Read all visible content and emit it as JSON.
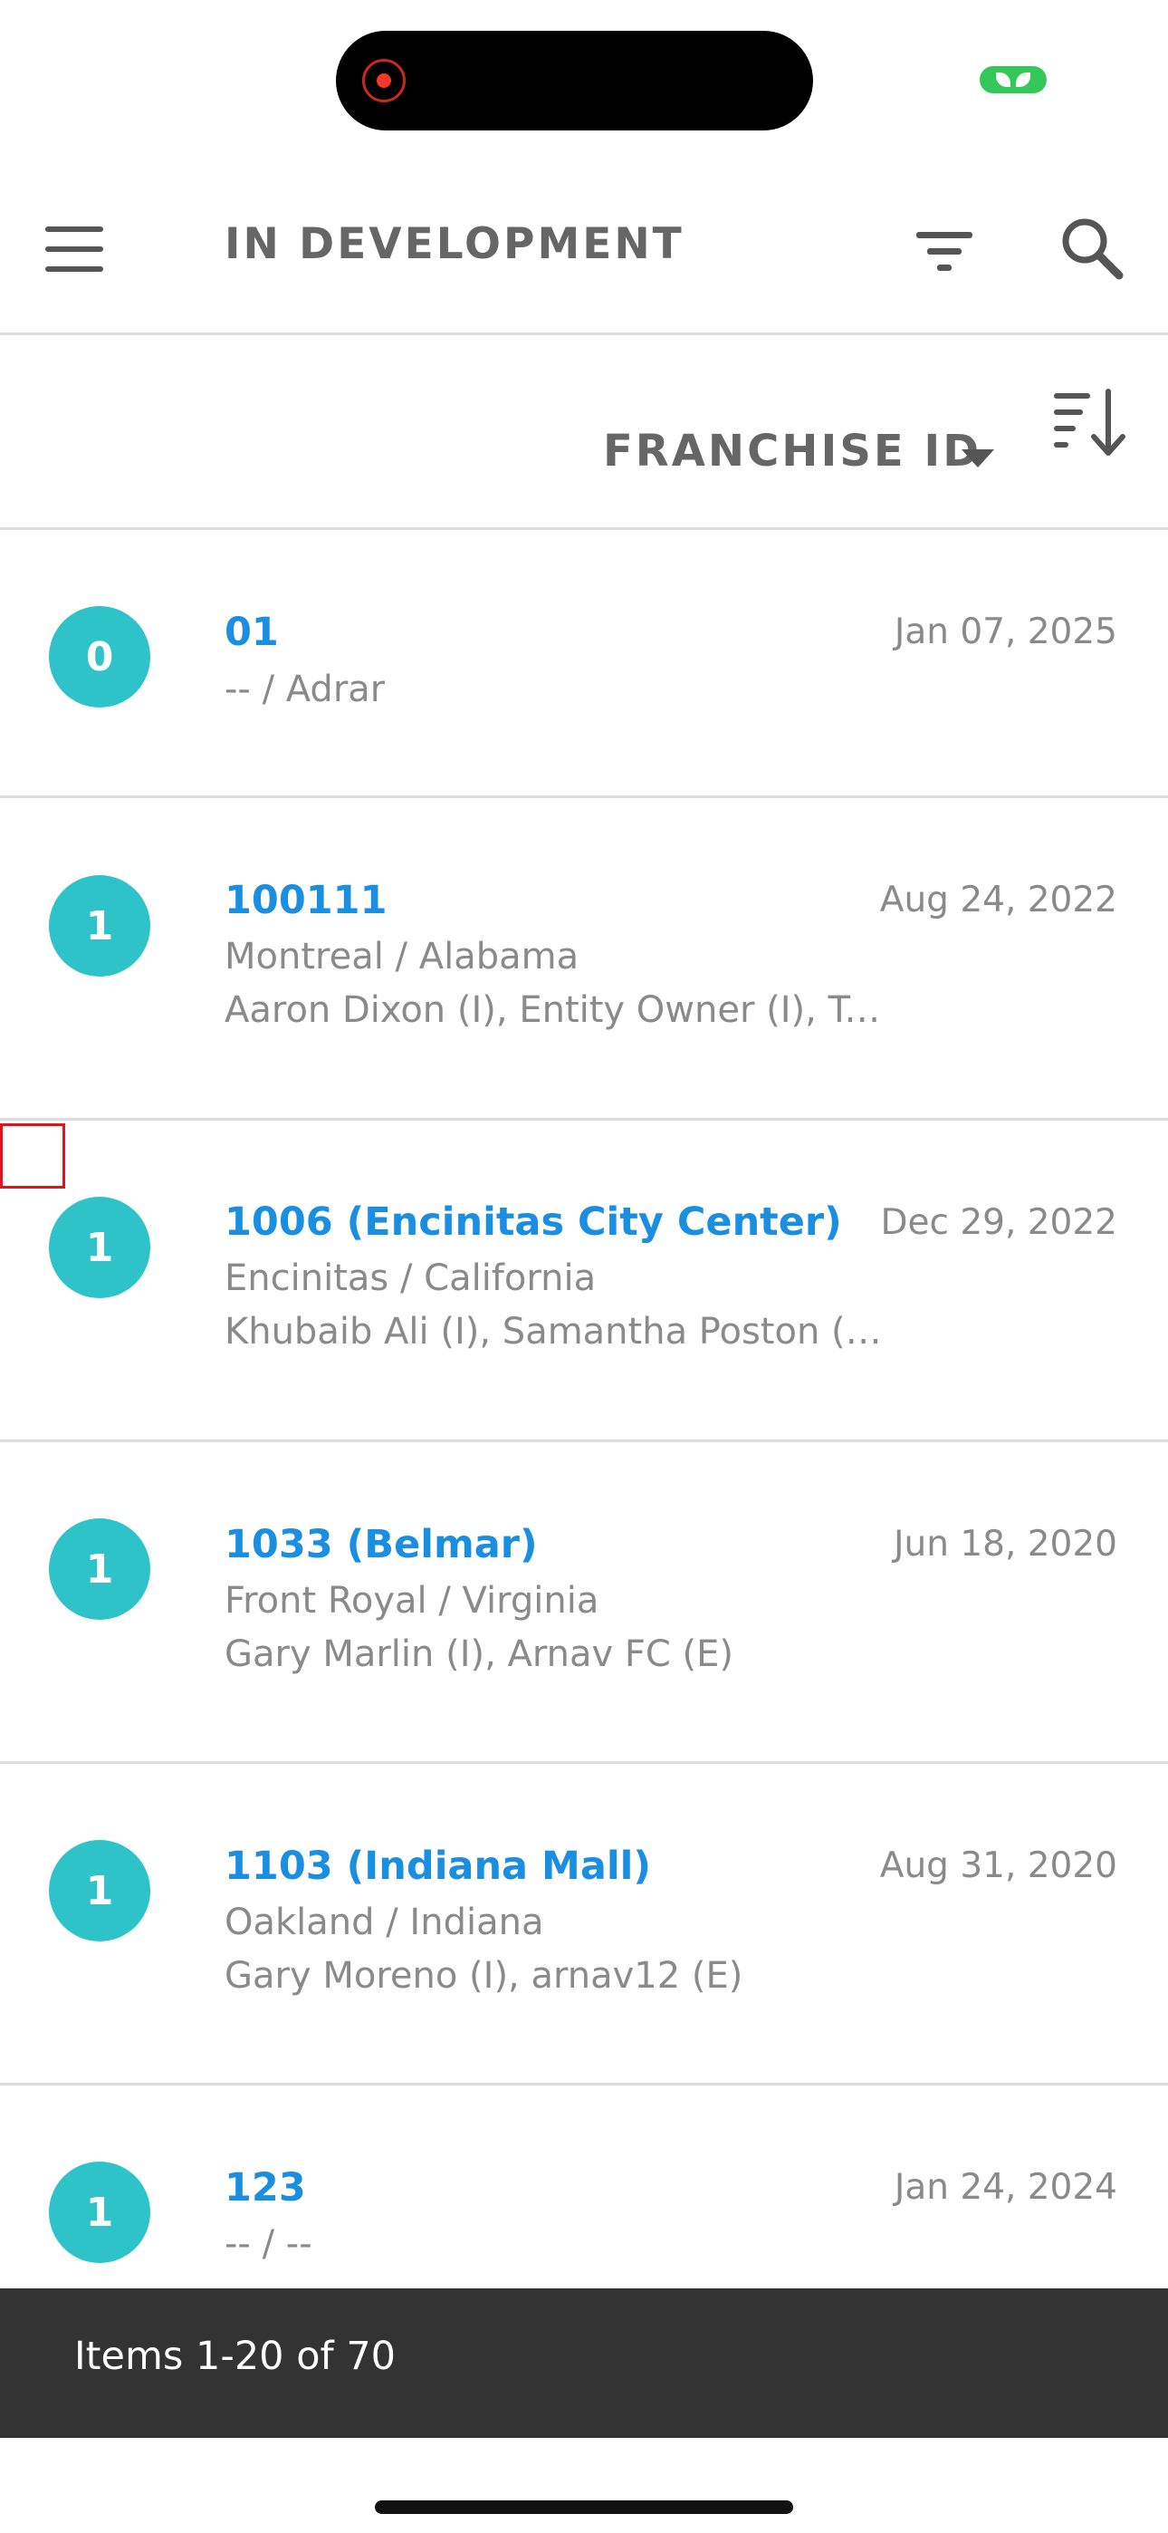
{
  "header": {
    "title": "IN DEVELOPMENT",
    "menu_icon": "hamburger-menu-icon",
    "filter_icon": "filter-icon",
    "search_icon": "search-icon"
  },
  "sort": {
    "label": "FRANCHISE ID",
    "order_icon": "sort-descending-icon"
  },
  "colors": {
    "accent": "#1a8ee0",
    "avatar": "#2ec3c9",
    "footer": "#333333",
    "call_indicator": "#34c759"
  },
  "items": [
    {
      "badge": "0",
      "title": "01",
      "date": "Jan 07, 2025",
      "location": "-- / Adrar",
      "owners": ""
    },
    {
      "badge": "1",
      "title": "100111",
      "date": "Aug 24, 2022",
      "location": "Montreal / Alabama",
      "owners": "Aaron Dixon (I), Entity Owner (I), Test…"
    },
    {
      "badge": "1",
      "title": "1006 (Encinitas City Center)",
      "date": "Dec 29, 2022",
      "location": "Encinitas / California",
      "owners": "Khubaib Ali (I), Samantha Poston (I), …"
    },
    {
      "badge": "1",
      "title": "1033 (Belmar)",
      "date": "Jun 18, 2020",
      "location": "Front Royal / Virginia",
      "owners": "Gary Marlin (I), Arnav FC (E)"
    },
    {
      "badge": "1",
      "title": "1103 (Indiana Mall)",
      "date": "Aug 31, 2020",
      "location": "Oakland / Indiana",
      "owners": "Gary Moreno (I), arnav12 (E)"
    },
    {
      "badge": "1",
      "title": "123",
      "date": "Jan 24, 2024",
      "location": "-- / --",
      "owners": ""
    }
  ],
  "footer": {
    "pagination": "Items 1-20 of 70"
  }
}
